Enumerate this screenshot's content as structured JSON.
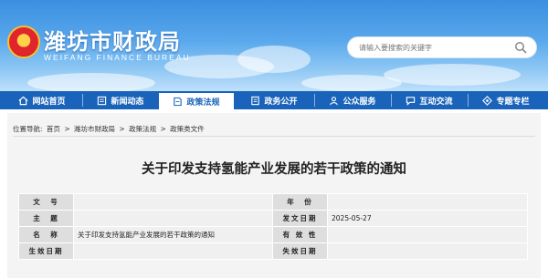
{
  "header": {
    "title": "潍坊市财政局",
    "subtitle": "WEIFANG FINANCE BUREAU",
    "search_placeholder": "请输入要搜索的关键字"
  },
  "nav": {
    "items": [
      {
        "label": "网站首页",
        "icon": "home-icon"
      },
      {
        "label": "新闻动态",
        "icon": "news-icon"
      },
      {
        "label": "政策法规",
        "icon": "policy-icon",
        "active": true
      },
      {
        "label": "政务公开",
        "icon": "document-icon"
      },
      {
        "label": "公众服务",
        "icon": "people-icon"
      },
      {
        "label": "互动交流",
        "icon": "chat-icon"
      },
      {
        "label": "专题专栏",
        "icon": "topic-icon"
      }
    ]
  },
  "breadcrumb": {
    "prefix": "位置导航:",
    "items": [
      "首页",
      "潍坊市财政局",
      "政策法规",
      "政策类文件"
    ],
    "separator": ">"
  },
  "article": {
    "title": "关于印发支持氢能产业发展的若干政策的通知"
  },
  "info": {
    "rows": [
      {
        "l1": "文　号",
        "v1": "",
        "l2": "年　份",
        "v2": ""
      },
      {
        "l1": "主　题",
        "v1": "",
        "l2": "发文日期",
        "v2": "2025-05-27"
      },
      {
        "l1": "名　称",
        "v1": "关于印发支持氢能产业发展的若干政策的通知",
        "l2": "有 效 性",
        "v2": ""
      },
      {
        "l1": "生效日期",
        "v1": "",
        "l2": "失效日期",
        "v2": ""
      }
    ]
  },
  "colors": {
    "nav_bg": "#1a63ba",
    "header_sky": "#3a8fe0"
  }
}
